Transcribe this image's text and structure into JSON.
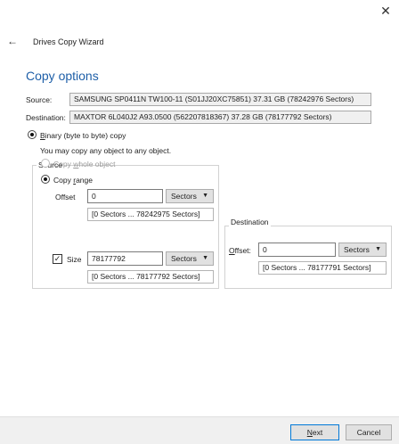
{
  "window": {
    "close_icon": "close-icon",
    "back_icon": "back-arrow-icon"
  },
  "header": {
    "title": "Drives Copy Wizard"
  },
  "main": {
    "heading": "Copy options",
    "source_label": "Source:",
    "source_value": "SAMSUNG SP0411N TW100-11 (S01JJ20XC75851) 37.31 GB (78242976 Sectors)",
    "destination_label": "Destination:",
    "destination_value": "MAXTOR 6L040J2 A93.0500 (562207818367) 37.28 GB (78177792 Sectors)",
    "binary_copy_first": "B",
    "binary_copy_rest": "inary (byte to byte) copy",
    "binary_copy_selected": true,
    "binary_copy_hint": "You may copy any object to any object."
  },
  "source_group": {
    "title": "Source",
    "copy_whole_prefix": "Copy ",
    "copy_whole_underlined": "w",
    "copy_whole_suffix": "hole object",
    "copy_range_prefix": "Copy ",
    "copy_range_underlined": "r",
    "copy_range_suffix": "ange",
    "offset_label": "Offset",
    "offset_value": "0",
    "offset_unit": "Sectors",
    "offset_range": "[0 Sectors ... 78242975 Sectors]",
    "size_label": "Size",
    "size_checked": true,
    "size_value": "78177792",
    "size_unit": "Sectors",
    "size_range": "[0 Sectors ... 78177792 Sectors]"
  },
  "destination_group": {
    "title": "Destination",
    "offset_label_underlined": "O",
    "offset_label_rest": "ffset:",
    "offset_value": "0",
    "offset_unit": "Sectors",
    "offset_range": "[0 Sectors ... 78177791 Sectors]"
  },
  "footer": {
    "next_underlined": "N",
    "next_rest": "ext",
    "cancel_label": "Cancel"
  }
}
